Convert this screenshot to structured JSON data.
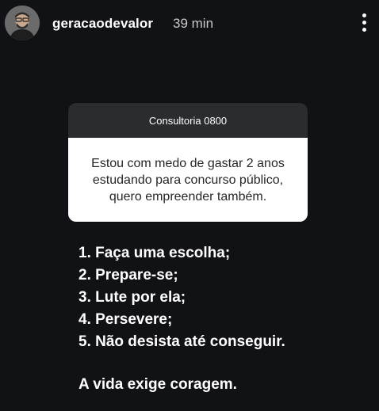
{
  "header": {
    "username": "geracaodevalor",
    "time": "39 min",
    "avatar_icon": "profile-photo",
    "more_icon": "vertical-ellipsis-icon"
  },
  "question_card": {
    "title": "Consultoria 0800",
    "question": "Estou com medo de gastar 2 anos estudando para concurso público, quero empreender também."
  },
  "answer": {
    "lines": [
      "1. Faça uma escolha;",
      "2. Prepare-se;",
      "3. Lute por ela;",
      "4. Persevere;",
      "5. Não desista até conseguir."
    ],
    "closing": "A vida exige coragem."
  },
  "colors": {
    "background": "#111216",
    "card_header": "#2b2c30",
    "card_body": "#ffffff"
  }
}
